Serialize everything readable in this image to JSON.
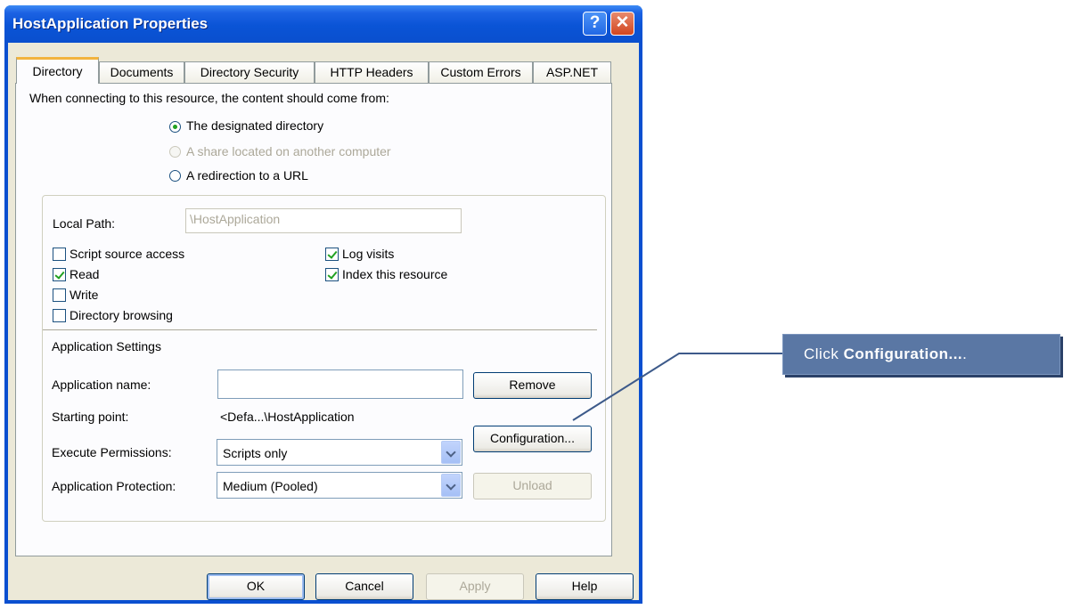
{
  "window": {
    "title": "HostApplication Properties",
    "help_glyph": "?",
    "close_glyph": "✕"
  },
  "tabs": [
    {
      "label": "Directory",
      "active": true
    },
    {
      "label": "Documents"
    },
    {
      "label": "Directory Security"
    },
    {
      "label": "HTTP Headers"
    },
    {
      "label": "Custom Errors"
    },
    {
      "label": "ASP.NET"
    }
  ],
  "content_source": {
    "prompt": "When connecting to this resource, the content should come from:",
    "options": [
      {
        "label": "The designated directory",
        "selected": true
      },
      {
        "label": "A share located on another computer",
        "disabled": true
      },
      {
        "label": "A redirection to a URL"
      }
    ]
  },
  "local_path": {
    "label": "Local Path:",
    "value": "\\HostApplication"
  },
  "permissions": {
    "script_source_access": {
      "label": "Script source access",
      "checked": false
    },
    "read": {
      "label": "Read",
      "checked": true
    },
    "write": {
      "label": "Write",
      "checked": false
    },
    "directory_browsing": {
      "label": "Directory browsing",
      "checked": false
    },
    "log_visits": {
      "label": "Log visits",
      "checked": true
    },
    "index_resource": {
      "label": "Index this resource",
      "checked": true
    }
  },
  "app_settings": {
    "heading": "Application Settings",
    "app_name_label": "Application name:",
    "app_name_value": "",
    "starting_point_label": "Starting point:",
    "starting_point_value": "<Defa...\\HostApplication",
    "exec_perm_label": "Execute Permissions:",
    "exec_perm_value": "Scripts only",
    "protection_label": "Application Protection:",
    "protection_value": "Medium (Pooled)",
    "remove_button": "Remove",
    "configuration_button": "Configuration...",
    "unload_button": "Unload"
  },
  "footer": {
    "ok": "OK",
    "cancel": "Cancel",
    "apply": "Apply",
    "help": "Help"
  },
  "callout": {
    "prefix": "Click ",
    "bold": "Configuration...",
    "suffix": "."
  },
  "colors": {
    "titlebar": "#0a54d6",
    "face": "#ece9d8",
    "callout": "#5a77a4",
    "check": "#21a121"
  }
}
